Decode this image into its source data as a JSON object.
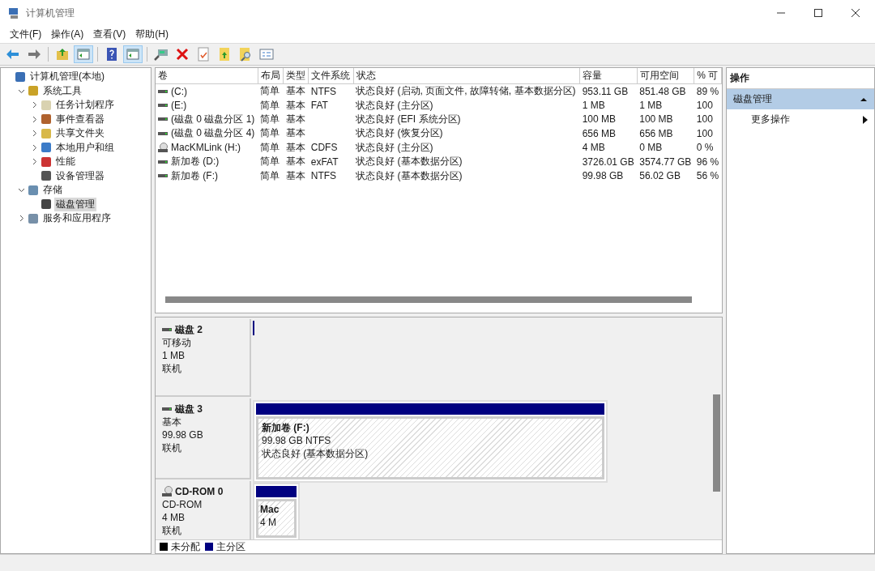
{
  "window": {
    "title": "计算机管理"
  },
  "menu": [
    "文件(F)",
    "操作(A)",
    "查看(V)",
    "帮助(H)"
  ],
  "toolbar": [
    {
      "kind": "back",
      "pressed": false
    },
    {
      "kind": "forward",
      "pressed": false
    },
    {
      "kind": "sep"
    },
    {
      "kind": "up",
      "pressed": false
    },
    {
      "kind": "pane",
      "pressed": true
    },
    {
      "kind": "sep"
    },
    {
      "kind": "help",
      "pressed": false
    },
    {
      "kind": "pane",
      "pressed": true
    },
    {
      "kind": "sep"
    },
    {
      "kind": "connect",
      "pressed": false
    },
    {
      "kind": "delete",
      "pressed": false
    },
    {
      "kind": "check",
      "pressed": false
    },
    {
      "kind": "folderup",
      "pressed": false
    },
    {
      "kind": "search",
      "pressed": false
    },
    {
      "kind": "list",
      "pressed": false
    }
  ],
  "tree": [
    {
      "label": "计算机管理(本地)",
      "kind": "computer",
      "selected": false,
      "children": [
        {
          "label": "系统工具",
          "kind": "tools",
          "expanded": true,
          "selected": false,
          "children": [
            {
              "label": "任务计划程序",
              "kind": "clock",
              "expanded": false,
              "selected": false
            },
            {
              "label": "事件查看器",
              "kind": "event",
              "expanded": false,
              "selected": false
            },
            {
              "label": "共享文件夹",
              "kind": "share",
              "expanded": false,
              "selected": false
            },
            {
              "label": "本地用户和组",
              "kind": "users",
              "expanded": false,
              "selected": false
            },
            {
              "label": "性能",
              "kind": "perf",
              "expanded": false,
              "selected": false
            },
            {
              "label": "设备管理器",
              "kind": "device",
              "selected": false
            }
          ]
        },
        {
          "label": "存储",
          "kind": "storage",
          "expanded": true,
          "selected": false,
          "children": [
            {
              "label": "磁盘管理",
              "kind": "disk",
              "selected": true
            }
          ]
        },
        {
          "label": "服务和应用程序",
          "kind": "services",
          "expanded": false,
          "selected": false
        }
      ]
    }
  ],
  "table": {
    "columns": [
      "卷",
      "布局",
      "类型",
      "文件系统",
      "状态",
      "容量",
      "可用空间",
      "% 可"
    ],
    "rows": [
      {
        "kind": "disk",
        "cells": [
          "(C:)",
          "简单",
          "基本",
          "NTFS",
          "状态良好 (启动, 页面文件, 故障转储, 基本数据分区)",
          "953.11 GB",
          "851.48 GB",
          "89 %"
        ]
      },
      {
        "kind": "disk",
        "cells": [
          "(E:)",
          "简单",
          "基本",
          "FAT",
          "状态良好 (主分区)",
          "1 MB",
          "1 MB",
          "100"
        ]
      },
      {
        "kind": "disk",
        "cells": [
          "(磁盘 0 磁盘分区 1)",
          "简单",
          "基本",
          "",
          "状态良好 (EFI 系统分区)",
          "100 MB",
          "100 MB",
          "100"
        ]
      },
      {
        "kind": "disk",
        "cells": [
          "(磁盘 0 磁盘分区 4)",
          "简单",
          "基本",
          "",
          "状态良好 (恢复分区)",
          "656 MB",
          "656 MB",
          "100"
        ]
      },
      {
        "kind": "cdrom",
        "cells": [
          "MacKMLink (H:)",
          "简单",
          "基本",
          "CDFS",
          "状态良好 (主分区)",
          "4 MB",
          "0 MB",
          "0 %"
        ]
      },
      {
        "kind": "disk",
        "cells": [
          "新加卷 (D:)",
          "简单",
          "基本",
          "exFAT",
          "状态良好 (基本数据分区)",
          "3726.01 GB",
          "3574.77 GB",
          "96 %"
        ]
      },
      {
        "kind": "disk",
        "cells": [
          "新加卷 (F:)",
          "简单",
          "基本",
          "NTFS",
          "状态良好 (基本数据分区)",
          "99.98 GB",
          "56.02 GB",
          "56 %"
        ]
      }
    ]
  },
  "disks": [
    {
      "kind": "removable",
      "name": "磁盘 2",
      "lines": [
        "可移动",
        "1 MB",
        "联机"
      ]
    },
    {
      "kind": "basic",
      "name": "磁盘 3",
      "lines": [
        "基本",
        "99.98 GB",
        "联机"
      ],
      "partitions": [
        {
          "lines": [
            "新加卷  (F:)",
            "99.98 GB NTFS",
            "状态良好 (基本数据分区)"
          ]
        }
      ]
    },
    {
      "kind": "cdrom",
      "name": "CD-ROM 0",
      "lines": [
        "CD-ROM",
        "4 MB",
        "联机"
      ],
      "partitions": [
        {
          "lines": [
            "Mac",
            "4 M"
          ]
        }
      ]
    }
  ],
  "legend": [
    {
      "label": "未分配",
      "color": "#000000"
    },
    {
      "label": "主分区",
      "color": "#000080"
    }
  ],
  "actions": {
    "title": "操作",
    "section": "磁盘管理",
    "items": [
      "更多操作"
    ]
  }
}
